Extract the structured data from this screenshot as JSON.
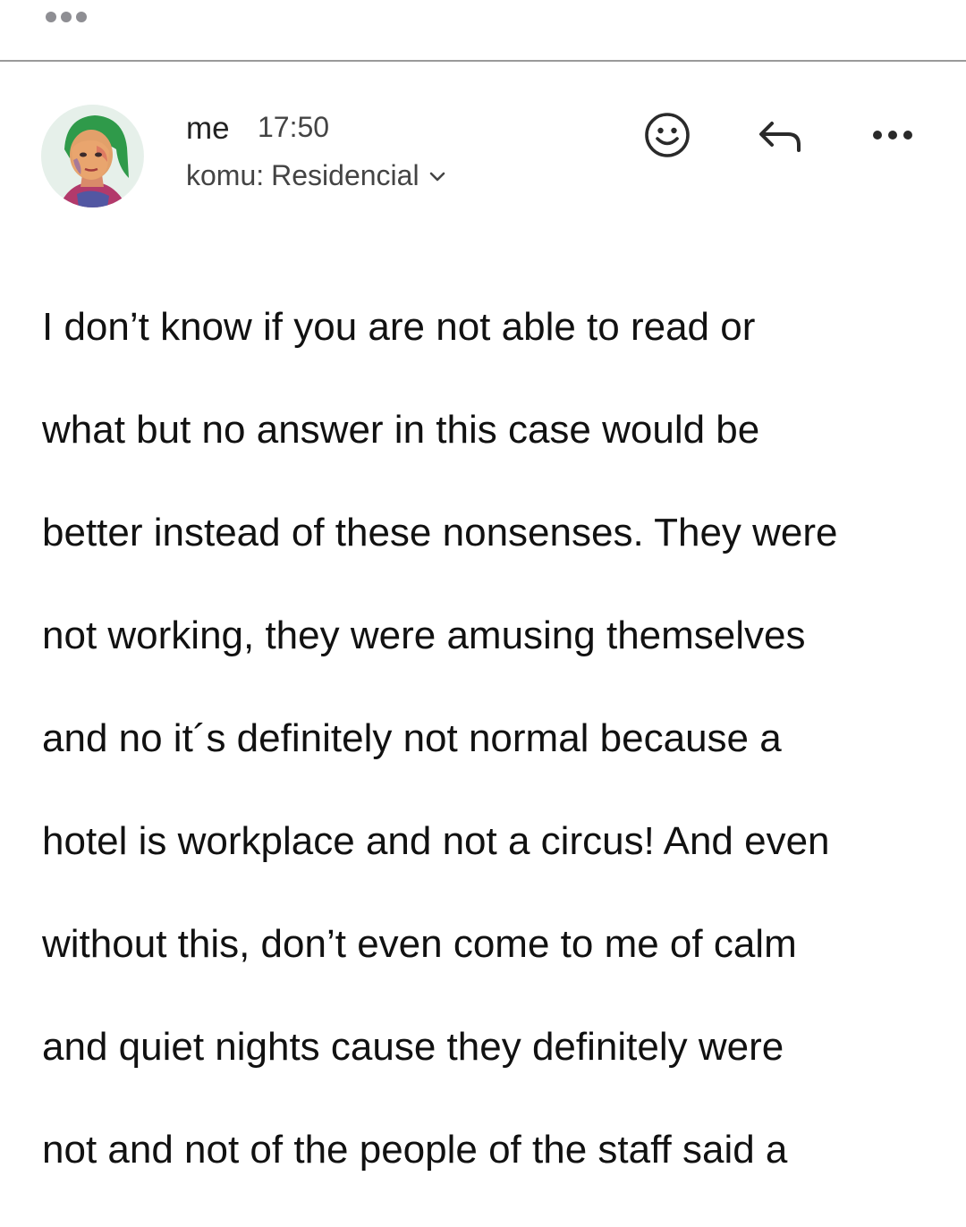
{
  "toolbar": {
    "more_icon": "more-horizontal-icon"
  },
  "message": {
    "sender": "me",
    "time": "17:50",
    "recipient_prefix": "komu:",
    "recipient": "Residencial",
    "actions": {
      "react_icon": "smiley-icon",
      "reply_icon": "reply-arrow-icon",
      "more_icon": "more-horizontal-icon"
    },
    "body_lines": [
      "I don’t know if you are not able to read or",
      "what but no answer in this case would be",
      "better instead of these nonsenses. They were",
      "not working, they were amusing themselves",
      "and no it´s definitely not normal because a",
      "hotel is workplace and not a circus! And even",
      "without this, don’t even come to me of calm",
      "and quiet nights cause they definitely were",
      "not and not of the people of the staff said a"
    ]
  },
  "colors": {
    "text": "#111111",
    "secondary_text": "#444444",
    "divider": "#9a9a9a",
    "dots_light": "#8e8e93"
  }
}
